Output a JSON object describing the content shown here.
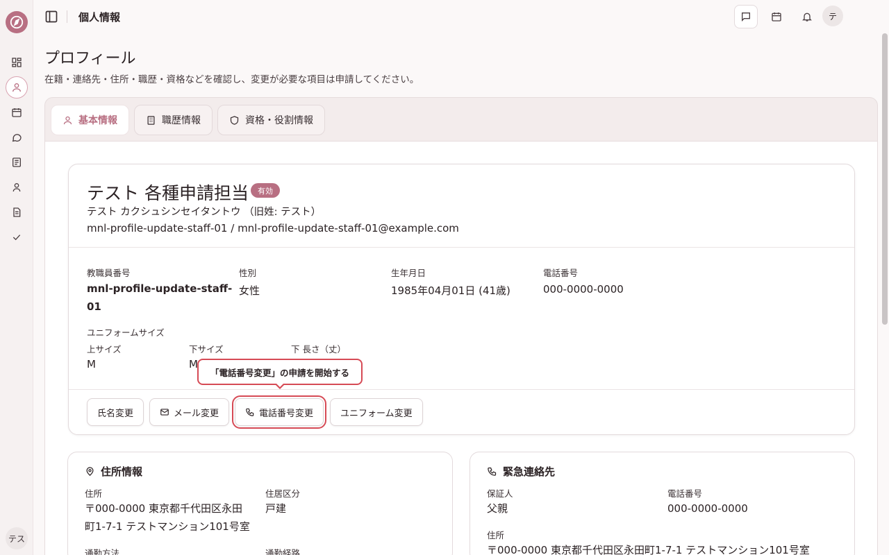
{
  "header": {
    "title": "個人情報",
    "avatar_label": "テ"
  },
  "sidebar": {
    "avatar_label": "テス",
    "items": [
      {
        "icon": "dashboard-icon"
      },
      {
        "icon": "user-icon",
        "active": true
      },
      {
        "icon": "calendar-icon"
      },
      {
        "icon": "chat-icon"
      },
      {
        "icon": "book-icon"
      },
      {
        "icon": "person-icon"
      },
      {
        "icon": "document-icon"
      },
      {
        "icon": "check-icon"
      }
    ]
  },
  "page": {
    "title": "プロフィール",
    "description": "在籍・連絡先・住所・職歴・資格などを確認し、変更が必要な項目は申請してください。"
  },
  "tabs": [
    {
      "label": "基本情報",
      "icon": "user-icon",
      "active": true
    },
    {
      "label": "職歴情報",
      "icon": "building-icon"
    },
    {
      "label": "資格・役割情報",
      "icon": "shield-icon"
    }
  ],
  "profile": {
    "name": "テスト 各種申請担当",
    "status_badge": "有効",
    "kana": "テスト カクシュシンセイタントウ （旧姓: テスト）",
    "ids": "mnl-profile-update-staff-01 / mnl-profile-update-staff-01@example.com",
    "fields": {
      "staff_no_label": "教職員番号",
      "staff_no": "mnl-profile-update-staff-01",
      "gender_label": "性別",
      "gender": "女性",
      "birthday_label": "生年月日",
      "birthday": "1985年04月01日 (41歳)",
      "phone_label": "電話番号",
      "phone": "000-0000-0000",
      "uniform_label": "ユニフォームサイズ",
      "top_label": "上サイズ",
      "top": "M",
      "bottom_label": "下サイズ",
      "bottom": "M",
      "length_label": "下 長さ（丈）"
    },
    "buttons": {
      "name_change": "氏名変更",
      "mail_change": "メール変更",
      "phone_change": "電話番号変更",
      "uniform_change": "ユニフォーム変更"
    },
    "tooltip": "「電話番号変更」の申請を開始する"
  },
  "address_card": {
    "title": "住所情報",
    "address_label": "住所",
    "address": "〒000-0000 東京都千代田区永田町1-7-1 テストマンション101号室",
    "residence_label": "住居区分",
    "residence": "戸建",
    "commute_label": "通勤方法",
    "route_label": "通勤経路"
  },
  "emergency_card": {
    "title": "緊急連絡先",
    "guarantor_label": "保証人",
    "guarantor": "父親",
    "phone_label": "電話番号",
    "phone": "000-0000-0000",
    "address_label": "住所",
    "address": "〒000-0000 東京都千代田区永田町1-7-1 テストマンション101号室"
  },
  "colors": {
    "accent": "#b86f82",
    "highlight": "#d64a55"
  }
}
